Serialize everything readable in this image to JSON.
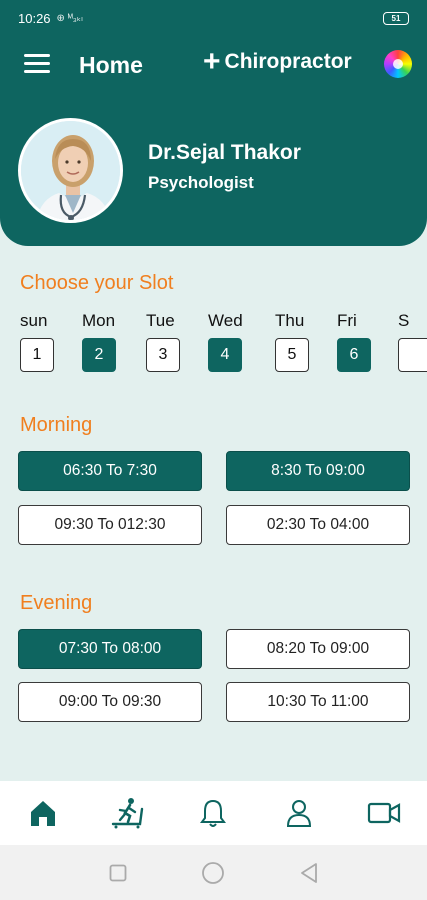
{
  "status_bar": {
    "time": "10:26",
    "network": "⊕ ᴹ₃ₖₗ",
    "battery": "51"
  },
  "header": {
    "title": "Home",
    "service": "Chiropractor",
    "doctor": {
      "name": "Dr.Sejal Thakor",
      "role": "Psychologist"
    }
  },
  "slot_section": {
    "title": "Choose your Slot"
  },
  "days": [
    {
      "name": "sun",
      "num": "1",
      "selected": false
    },
    {
      "name": "Mon",
      "num": "2",
      "selected": true
    },
    {
      "name": "Tue",
      "num": "3",
      "selected": false
    },
    {
      "name": "Wed",
      "num": "4",
      "selected": true
    },
    {
      "name": "Thu",
      "num": "5",
      "selected": false
    },
    {
      "name": "Fri",
      "num": "6",
      "selected": true
    },
    {
      "name": "S",
      "num": "",
      "selected": false
    }
  ],
  "morning": {
    "title": "Morning",
    "slots": [
      {
        "label": "06:30  To  7:30",
        "selected": true
      },
      {
        "label": "8:30  To  09:00",
        "selected": true
      },
      {
        "label": "09:30  To  012:30",
        "selected": false
      },
      {
        "label": "02:30  To  04:00",
        "selected": false
      }
    ]
  },
  "evening": {
    "title": "Evening",
    "slots": [
      {
        "label": "07:30  To  08:00",
        "selected": true
      },
      {
        "label": "08:20  To  09:00",
        "selected": false
      },
      {
        "label": "09:00  To  09:30",
        "selected": false
      },
      {
        "label": "10:30  To  11:00",
        "selected": false
      }
    ]
  },
  "nav": {
    "items": [
      {
        "icon": "home-icon",
        "active": true
      },
      {
        "icon": "treadmill-icon",
        "active": false
      },
      {
        "icon": "bell-icon",
        "active": false
      },
      {
        "icon": "user-icon",
        "active": false
      },
      {
        "icon": "video-camera-icon",
        "active": false
      }
    ]
  },
  "colors": {
    "primary": "#0e6560",
    "accent": "#f07f1f",
    "background": "#e3f0ee"
  }
}
